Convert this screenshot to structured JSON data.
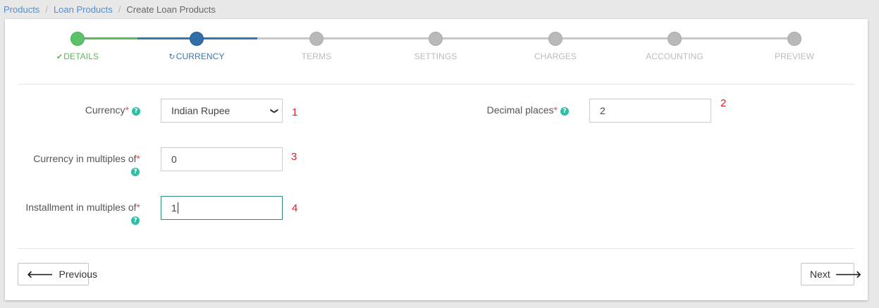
{
  "breadcrumb": {
    "items": [
      "Products",
      "Loan Products"
    ],
    "current": "Create Loan Products",
    "separator": "/"
  },
  "stepper": {
    "steps": [
      {
        "label": "DETAILS",
        "state": "done",
        "icon": "check-icon"
      },
      {
        "label": "CURRENCY",
        "state": "active",
        "icon": "refresh-icon"
      },
      {
        "label": "TERMS",
        "state": "pending"
      },
      {
        "label": "SETTINGS",
        "state": "pending"
      },
      {
        "label": "CHARGES",
        "state": "pending"
      },
      {
        "label": "ACCOUNTING",
        "state": "pending"
      },
      {
        "label": "PREVIEW",
        "state": "pending"
      }
    ]
  },
  "form": {
    "currency": {
      "label": "Currency",
      "required_mark": "*",
      "value": "Indian Rupee",
      "marker": "1"
    },
    "decimal_places": {
      "label": "Decimal places",
      "required_mark": "*",
      "value": "2",
      "marker": "2"
    },
    "currency_multiples": {
      "label": "Currency in multiples of",
      "required_mark": "*",
      "value": "0",
      "marker": "3"
    },
    "installment_multiples": {
      "label": "Installment in multiples of",
      "required_mark": "*",
      "value": "1",
      "marker": "4"
    },
    "help_glyph": "?"
  },
  "buttons": {
    "previous": "Previous",
    "next": "Next"
  },
  "colors": {
    "done": "#5cb85c",
    "active": "#3a74ad",
    "pending": "#c8c8c8",
    "required": "#e05252",
    "help": "#2ebfa5",
    "marker": "#e02020"
  }
}
